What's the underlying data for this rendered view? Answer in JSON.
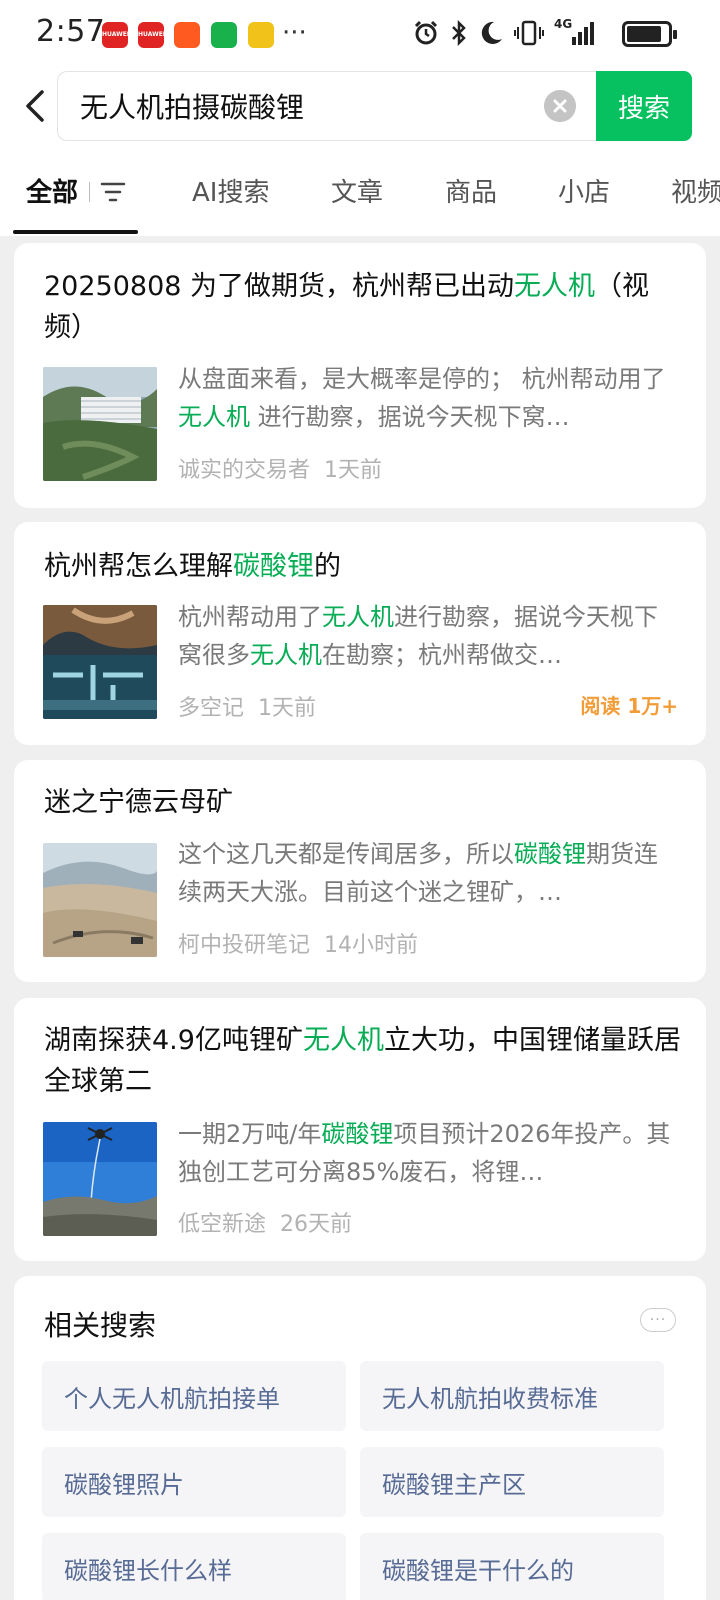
{
  "status_bar": {
    "time": "2:57",
    "network": "4G",
    "more": "···",
    "battery_level": 0.85
  },
  "search": {
    "query": "无人机拍摄碳酸锂",
    "button_label": "搜索"
  },
  "tabs": [
    "全部",
    "AI搜索",
    "文章",
    "商品",
    "小店",
    "视频"
  ],
  "results": [
    {
      "title_parts": [
        "20250808 为了做期货，杭州帮已出动",
        "无人机",
        "（视频）"
      ],
      "snippet_parts": [
        "从盘面来看，是大概率是停的； 杭州帮动用了",
        "无人机",
        " 进行勘察，据说今天枧下窝…"
      ],
      "author": "诚实的交易者",
      "time": "1天前",
      "read_count": ""
    },
    {
      "title_parts": [
        "杭州帮怎么理解",
        "碳酸锂",
        "的"
      ],
      "snippet_parts": [
        "杭州帮动用了",
        "无人机",
        "进行勘察，据说今天枧下窝很多",
        "无人机",
        "在勘察；杭州帮做交…"
      ],
      "author": "多空记",
      "time": "1天前",
      "read_count": "阅读 1万+"
    },
    {
      "title_parts": [
        "迷之宁德云母矿"
      ],
      "snippet_parts": [
        "这个这几天都是传闻居多，所以",
        "碳酸锂",
        "期货连续两天大涨。目前这个迷之锂矿，…"
      ],
      "author": "柯中投研笔记",
      "time": "14小时前",
      "read_count": ""
    },
    {
      "title_parts": [
        "湖南探获4.9亿吨锂矿",
        "无人机",
        "立大功，中国锂储量跃居全球第二"
      ],
      "snippet_parts": [
        "一期2万吨/年",
        "碳酸锂",
        "项目预计2026年投产。其独创工艺可分离85%废石，将锂…"
      ],
      "author": "低空新途",
      "time": "26天前",
      "read_count": ""
    }
  ],
  "related": {
    "title": "相关搜索",
    "more": "···",
    "items": [
      "个人无人机航拍接单",
      "无人机航拍收费标准",
      "碳酸锂照片",
      "碳酸锂主产区",
      "碳酸锂长什么样",
      "碳酸锂是干什么的"
    ]
  },
  "colors": {
    "accent_green": "#07c160",
    "highlight_green": "#07ad55",
    "read_count_orange": "#f29c38",
    "link_blue": "#576b95"
  }
}
